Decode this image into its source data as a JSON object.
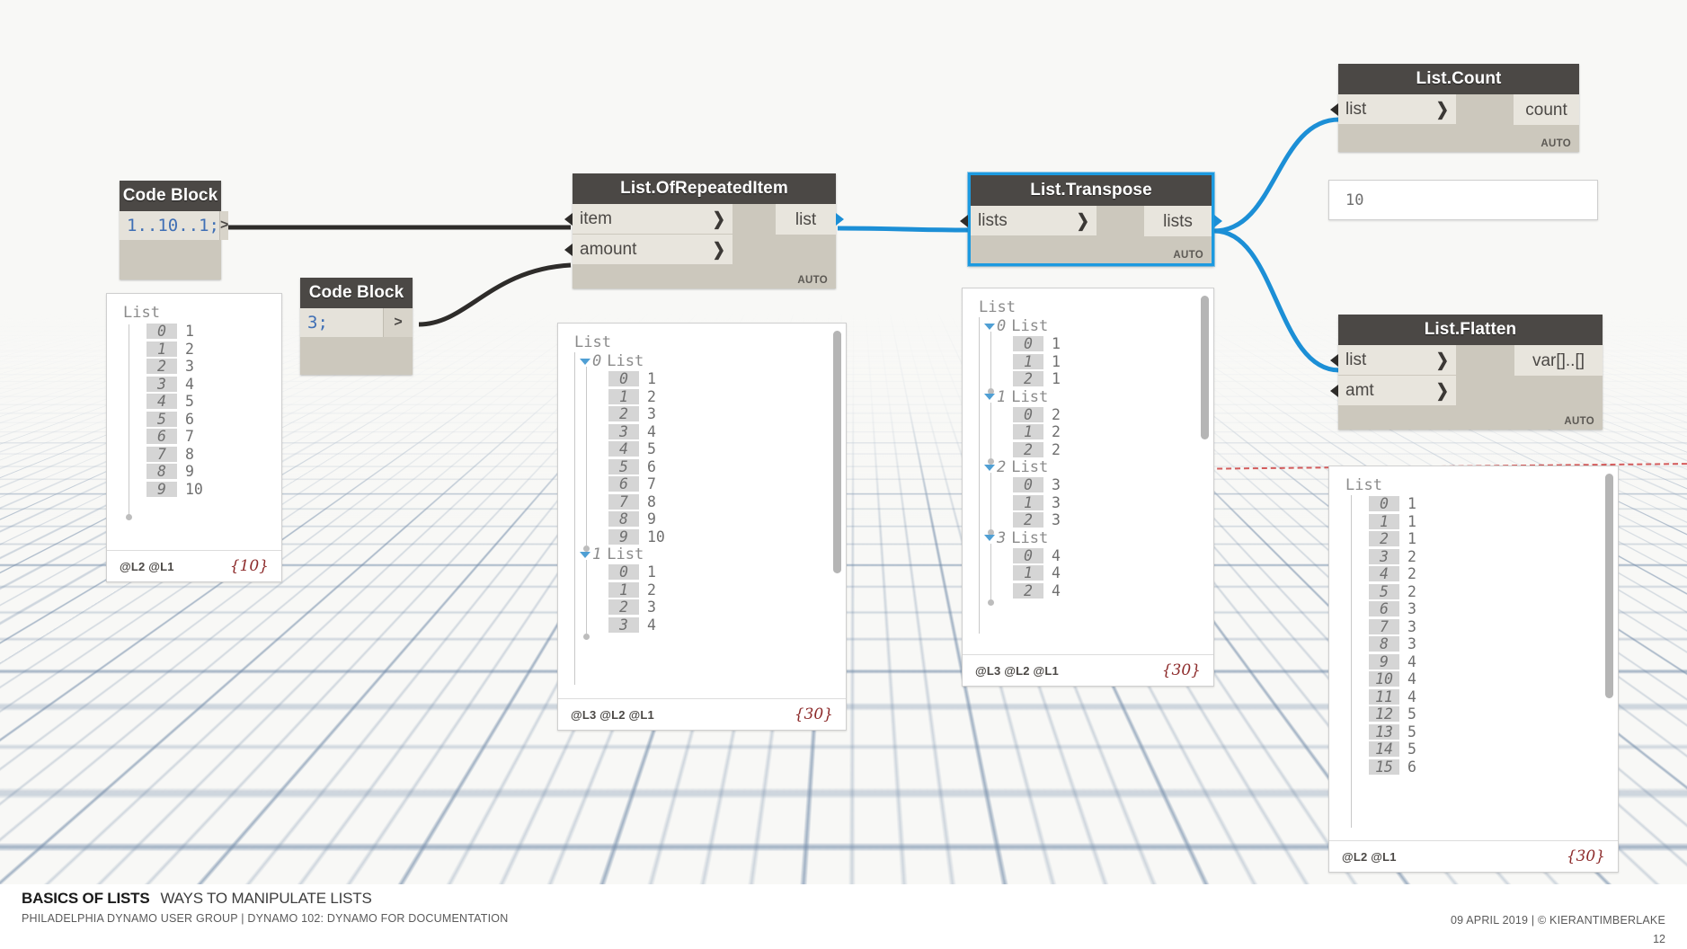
{
  "slide": {
    "title_bold": "BASICS OF LISTS",
    "title_light": "WAYS TO MANIPULATE LISTS",
    "subtitle": "PHILADELPHIA DYNAMO USER GROUP  |  DYNAMO 102:  DYNAMO FOR DOCUMENTATION",
    "credit": "09 APRIL 2019  |  © KIERANTIMBERLAKE",
    "page_number": "12"
  },
  "colors": {
    "node_header": "#4b4845",
    "node_body": "#ccc8bd",
    "port_bg": "#e8e5dd",
    "selection": "#1c9ae0",
    "wire_default": "#2e2c2a",
    "wire_active": "#1c8fd6",
    "count_tag": "#8d2b2b",
    "code_literal": "#3f6fb5"
  },
  "nodes": {
    "code_block_1": {
      "title": "Code Block",
      "code": "1..10..1;",
      "output_chevron": ">"
    },
    "code_block_2": {
      "title": "Code Block",
      "code": "3;",
      "output_chevron": ">"
    },
    "list_of_repeated_item": {
      "title": "List.OfRepeatedItem",
      "inputs": [
        {
          "label": "item",
          "chevron": "❯"
        },
        {
          "label": "amount",
          "chevron": "❯"
        }
      ],
      "outputs": [
        {
          "label": "list"
        }
      ],
      "lacing_tag": "AUTO"
    },
    "list_transpose": {
      "title": "List.Transpose",
      "selected": true,
      "inputs": [
        {
          "label": "lists",
          "chevron": "❯"
        }
      ],
      "outputs": [
        {
          "label": "lists"
        }
      ],
      "lacing_tag": "AUTO"
    },
    "list_count": {
      "title": "List.Count",
      "inputs": [
        {
          "label": "list",
          "chevron": "❯"
        }
      ],
      "outputs": [
        {
          "label": "count"
        }
      ],
      "lacing_tag": "AUTO",
      "result_value": "10"
    },
    "list_flatten": {
      "title": "List.Flatten",
      "inputs": [
        {
          "label": "list",
          "chevron": "❯"
        },
        {
          "label": "amt",
          "chevron": "❯"
        }
      ],
      "outputs": [
        {
          "label": "var[]..[]"
        }
      ],
      "lacing_tag": "AUTO"
    }
  },
  "previews": {
    "code_block_1_preview": {
      "root_label": "List",
      "items": [
        {
          "index": "0",
          "value": "1"
        },
        {
          "index": "1",
          "value": "2"
        },
        {
          "index": "2",
          "value": "3"
        },
        {
          "index": "3",
          "value": "4"
        },
        {
          "index": "4",
          "value": "5"
        },
        {
          "index": "5",
          "value": "6"
        },
        {
          "index": "6",
          "value": "7"
        },
        {
          "index": "7",
          "value": "8"
        },
        {
          "index": "8",
          "value": "9"
        },
        {
          "index": "9",
          "value": "10"
        }
      ],
      "lacing": "@L2 @L1",
      "count": "{10}"
    },
    "repeated_item_preview": {
      "root_label": "List",
      "sublists": [
        {
          "index": "0",
          "label": "List",
          "items": [
            {
              "index": "0",
              "value": "1"
            },
            {
              "index": "1",
              "value": "2"
            },
            {
              "index": "2",
              "value": "3"
            },
            {
              "index": "3",
              "value": "4"
            },
            {
              "index": "4",
              "value": "5"
            },
            {
              "index": "5",
              "value": "6"
            },
            {
              "index": "6",
              "value": "7"
            },
            {
              "index": "7",
              "value": "8"
            },
            {
              "index": "8",
              "value": "9"
            },
            {
              "index": "9",
              "value": "10"
            }
          ]
        },
        {
          "index": "1",
          "label": "List",
          "items": [
            {
              "index": "0",
              "value": "1"
            },
            {
              "index": "1",
              "value": "2"
            },
            {
              "index": "2",
              "value": "3"
            },
            {
              "index": "3",
              "value": "4"
            }
          ]
        }
      ],
      "lacing": "@L3 @L2 @L1",
      "count": "{30}"
    },
    "transpose_preview": {
      "root_label": "List",
      "sublists": [
        {
          "index": "0",
          "label": "List",
          "items": [
            {
              "index": "0",
              "value": "1"
            },
            {
              "index": "1",
              "value": "1"
            },
            {
              "index": "2",
              "value": "1"
            }
          ]
        },
        {
          "index": "1",
          "label": "List",
          "items": [
            {
              "index": "0",
              "value": "2"
            },
            {
              "index": "1",
              "value": "2"
            },
            {
              "index": "2",
              "value": "2"
            }
          ]
        },
        {
          "index": "2",
          "label": "List",
          "items": [
            {
              "index": "0",
              "value": "3"
            },
            {
              "index": "1",
              "value": "3"
            },
            {
              "index": "2",
              "value": "3"
            }
          ]
        },
        {
          "index": "3",
          "label": "List",
          "items": [
            {
              "index": "0",
              "value": "4"
            },
            {
              "index": "1",
              "value": "4"
            },
            {
              "index": "2",
              "value": "4"
            }
          ]
        }
      ],
      "lacing": "@L3 @L2 @L1",
      "count": "{30}"
    },
    "flatten_preview": {
      "root_label": "List",
      "items": [
        {
          "index": "0",
          "value": "1"
        },
        {
          "index": "1",
          "value": "1"
        },
        {
          "index": "2",
          "value": "1"
        },
        {
          "index": "3",
          "value": "2"
        },
        {
          "index": "4",
          "value": "2"
        },
        {
          "index": "5",
          "value": "2"
        },
        {
          "index": "6",
          "value": "3"
        },
        {
          "index": "7",
          "value": "3"
        },
        {
          "index": "8",
          "value": "3"
        },
        {
          "index": "9",
          "value": "4"
        },
        {
          "index": "10",
          "value": "4"
        },
        {
          "index": "11",
          "value": "4"
        },
        {
          "index": "12",
          "value": "5"
        },
        {
          "index": "13",
          "value": "5"
        },
        {
          "index": "14",
          "value": "5"
        },
        {
          "index": "15",
          "value": "6"
        }
      ],
      "lacing": "@L2 @L1",
      "count": "{30}"
    }
  }
}
